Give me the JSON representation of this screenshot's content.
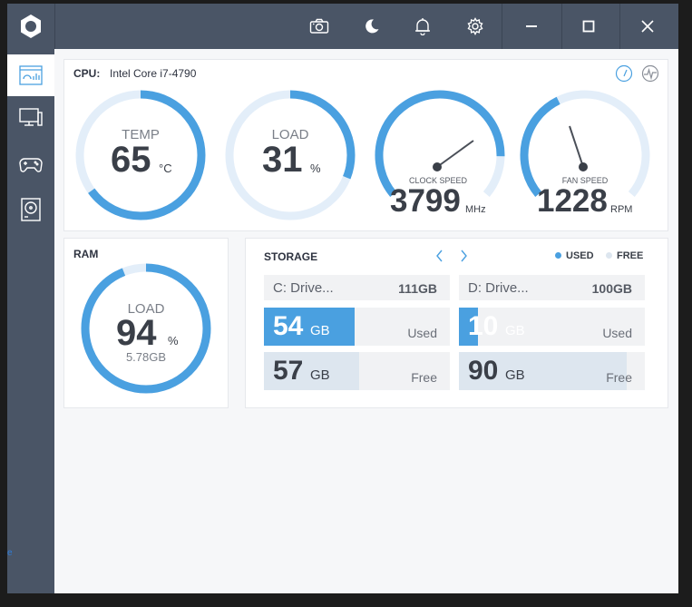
{
  "colors": {
    "accent": "#4aa0e0",
    "track": "#e3eef9",
    "sidebar": "#4a5566",
    "free_fill": "#dde6ef"
  },
  "titlebar": {
    "icons": [
      "camera-icon",
      "moon-icon",
      "bell-icon",
      "gear-icon",
      "minimize-icon",
      "maximize-icon",
      "close-icon"
    ]
  },
  "sidebar": {
    "items": [
      {
        "icon": "dashboard-icon",
        "active": true
      },
      {
        "icon": "monitor-icon",
        "active": false
      },
      {
        "icon": "gamepad-icon",
        "active": false
      },
      {
        "icon": "disk-icon",
        "active": false
      }
    ]
  },
  "cpu": {
    "label": "CPU:",
    "model": "Intel Core i7-4790",
    "temp": {
      "label": "TEMP",
      "value": "65",
      "unit": "°C",
      "fraction": 0.65
    },
    "load": {
      "label": "LOAD",
      "value": "31",
      "unit": "%",
      "fraction": 0.31
    },
    "clock": {
      "label": "CLOCK SPEED",
      "value": "3799",
      "unit": "MHz",
      "fraction": 0.85
    },
    "fan": {
      "label": "FAN SPEED",
      "value": "1228",
      "unit": "RPM",
      "fraction": 0.4
    }
  },
  "ram": {
    "title": "RAM",
    "label": "LOAD",
    "value": "94",
    "unit": "%",
    "amount": "5.78GB",
    "fraction": 0.94
  },
  "storage": {
    "title": "STORAGE",
    "legend_used": "USED",
    "legend_free": "FREE",
    "drives": [
      {
        "name": "C: Drive...",
        "size": "111GB",
        "used": "54",
        "free": "57",
        "used_fraction": 0.49,
        "free_fraction": 0.51,
        "unit": "GB",
        "used_label": "Used",
        "free_label": "Free"
      },
      {
        "name": "D: Drive...",
        "size": "100GB",
        "used": "10",
        "free": "90",
        "used_fraction": 0.1,
        "free_fraction": 0.9,
        "unit": "GB",
        "used_label": "Used",
        "free_label": "Free"
      }
    ]
  },
  "edge_text": "e"
}
